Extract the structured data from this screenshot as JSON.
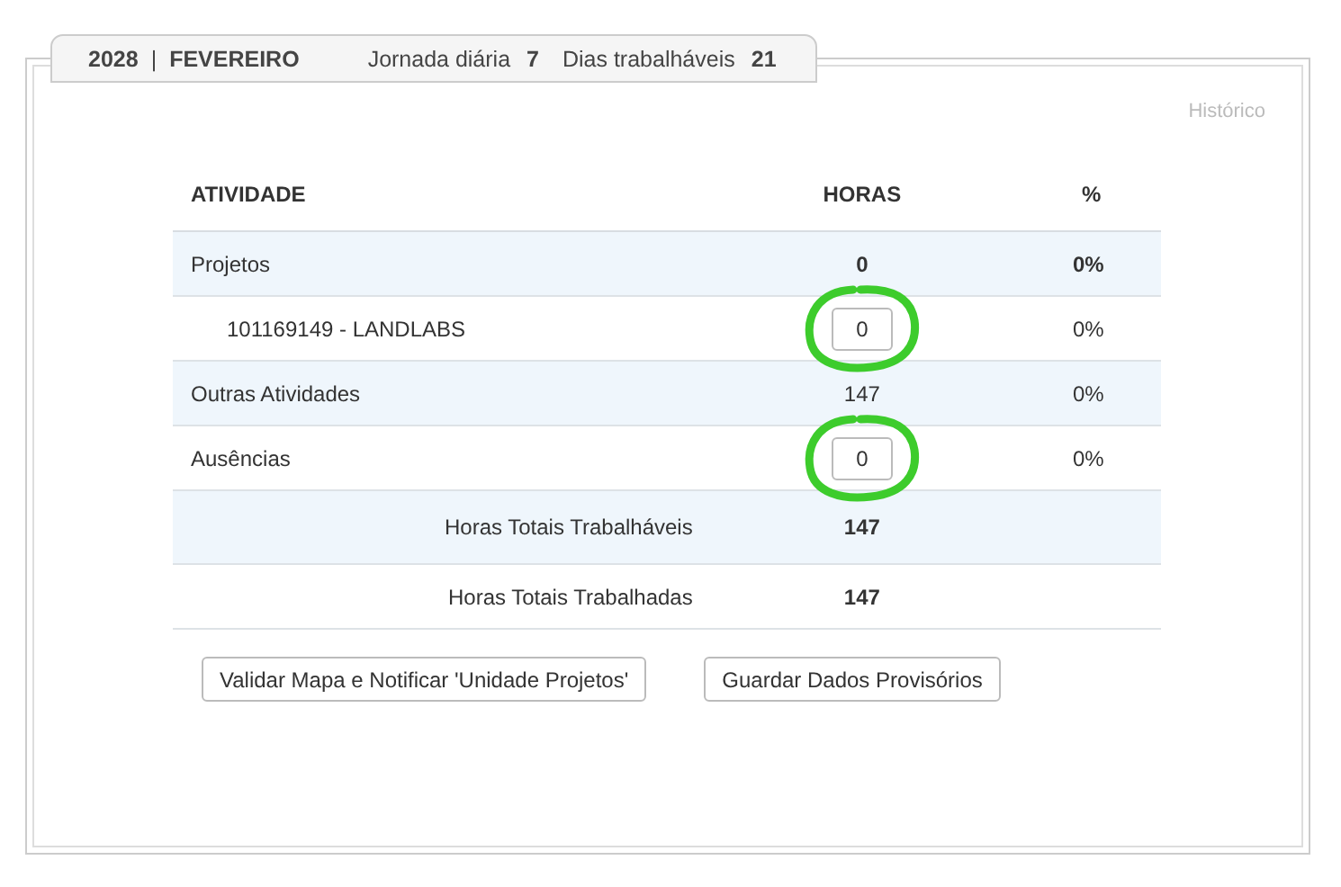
{
  "header": {
    "year": "2028",
    "separator": "|",
    "month": "FEVEREIRO",
    "jornada_label": "Jornada diária",
    "jornada_value": "7",
    "dias_label": "Dias trabalháveis",
    "dias_value": "21"
  },
  "history_link": "Histórico",
  "table": {
    "columns": [
      "ATIVIDADE",
      "HORAS",
      "%"
    ],
    "rows": [
      {
        "kind": "group",
        "label": "Projetos",
        "hours": "0",
        "percent": "0%",
        "editable": false,
        "circled": false
      },
      {
        "kind": "subitem",
        "label": "101169149 - LANDLABS",
        "hours": "0",
        "percent": "0%",
        "editable": true,
        "circled": true
      },
      {
        "kind": "activity",
        "label": "Outras Atividades",
        "hours": "147",
        "percent": "0%",
        "editable": false,
        "circled": false
      },
      {
        "kind": "activity",
        "label": "Ausências",
        "hours": "0",
        "percent": "0%",
        "editable": true,
        "circled": true
      },
      {
        "kind": "total",
        "label": "Horas Totais Trabalháveis",
        "hours": "147",
        "editable": false,
        "circled": false
      },
      {
        "kind": "total",
        "label": "Horas Totais Trabalhadas",
        "hours": "147",
        "editable": false,
        "circled": false
      }
    ]
  },
  "buttons": [
    "Validar Mapa e Notificar 'Unidade Projetos'",
    "Guardar Dados Provisórios"
  ]
}
